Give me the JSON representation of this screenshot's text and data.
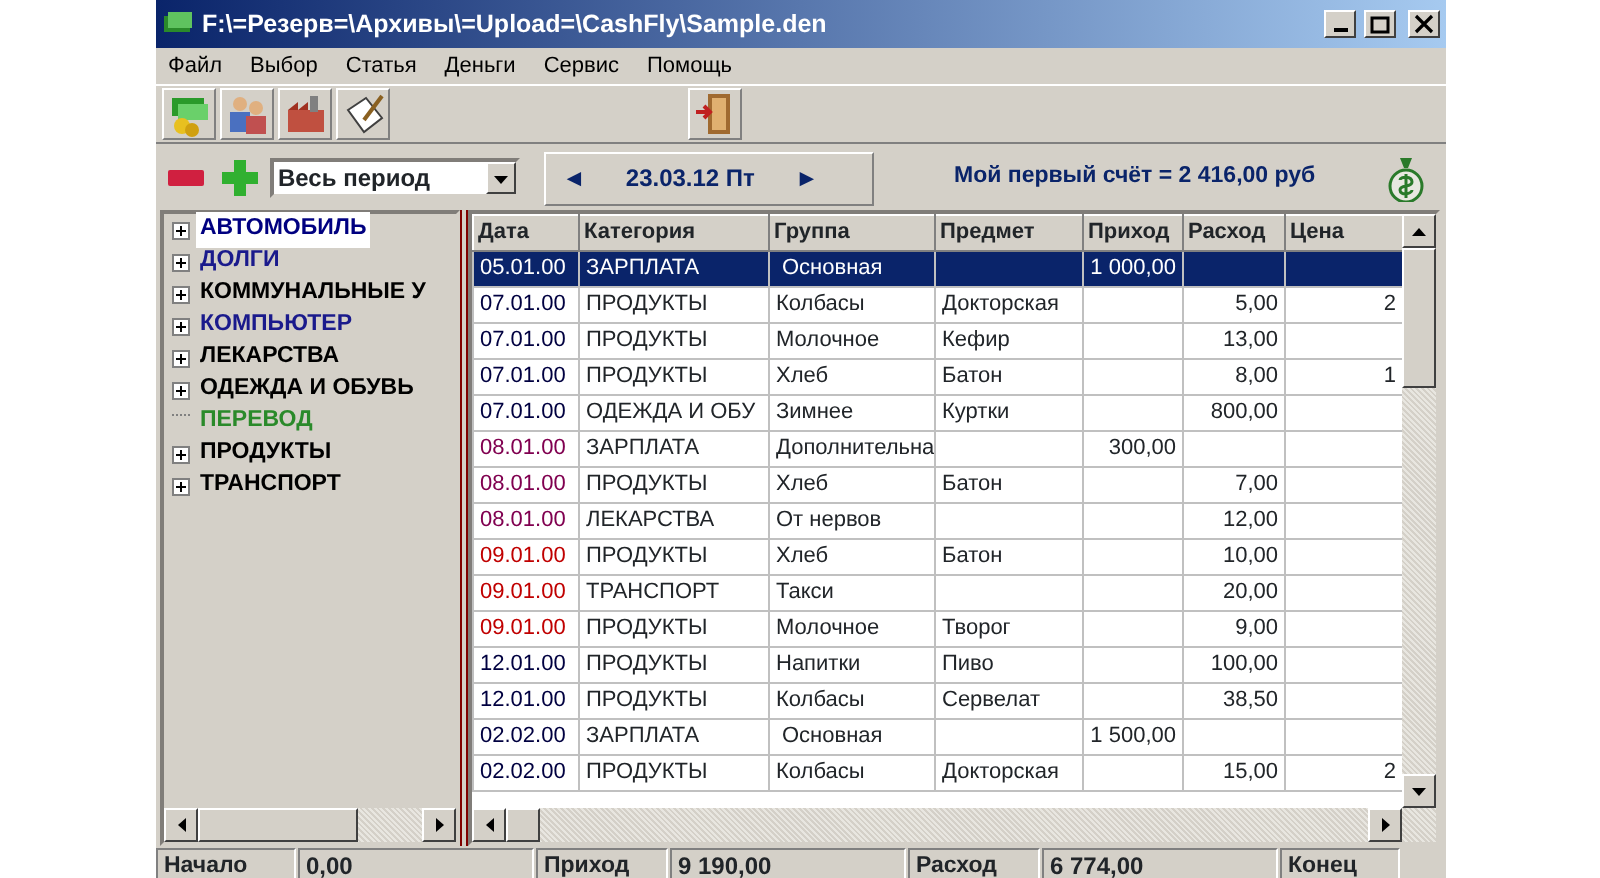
{
  "window": {
    "title": "F:\\=Резерв=\\Архивы\\=Upload=\\CashFly\\Sample.den"
  },
  "menu": [
    "Файл",
    "Выбор",
    "Статья",
    "Деньги",
    "Сервис",
    "Помощь"
  ],
  "period": {
    "value": "Весь период"
  },
  "date_nav": {
    "prev": "◄",
    "date": "23.03.12 Пт",
    "next": "►"
  },
  "account": "Мой первый счёт = 2 416,00 руб",
  "tree": [
    {
      "label": "АВТОМОБИЛЬ",
      "color": "#000080",
      "expandable": true,
      "selected": true
    },
    {
      "label": "ДОЛГИ",
      "color": "#1a1a8c",
      "expandable": true,
      "selected": false
    },
    {
      "label": "КОММУНАЛЬНЫЕ У",
      "color": "#000000",
      "expandable": true,
      "selected": false
    },
    {
      "label": "КОМПЬЮТЕР",
      "color": "#1a1a8c",
      "expandable": true,
      "selected": false
    },
    {
      "label": "ЛЕКАРСТВА",
      "color": "#000000",
      "expandable": true,
      "selected": false
    },
    {
      "label": "ОДЕЖДА И ОБУВЬ",
      "color": "#000000",
      "expandable": true,
      "selected": false
    },
    {
      "label": "ПЕРЕВОД",
      "color": "#2a8a2a",
      "expandable": false,
      "selected": false
    },
    {
      "label": "ПРОДУКТЫ",
      "color": "#000000",
      "expandable": true,
      "selected": false
    },
    {
      "label": "ТРАНСПОРТ",
      "color": "#000000",
      "expandable": true,
      "selected": false
    }
  ],
  "table": {
    "columns": [
      "Дата",
      "Категория",
      "Группа",
      "Предмет",
      "Приход",
      "Расход",
      "Цена"
    ],
    "rows": [
      {
        "cells": [
          "05.01.00",
          "ЗАРПЛАТА",
          "Основная",
          "",
          "1 000,00",
          "",
          ""
        ],
        "selected": true
      },
      {
        "cells": [
          "07.01.00",
          "ПРОДУКТЫ",
          "Колбасы",
          "Докторская",
          "",
          "5,00",
          "2"
        ],
        "color": "#000040",
        "selected": false
      },
      {
        "cells": [
          "07.01.00",
          "ПРОДУКТЫ",
          "Молочное",
          "Кефир",
          "",
          "13,00",
          ""
        ],
        "color": "#000040",
        "selected": false
      },
      {
        "cells": [
          "07.01.00",
          "ПРОДУКТЫ",
          "Хлеб",
          "Батон",
          "",
          "8,00",
          "1"
        ],
        "color": "#000040",
        "selected": false
      },
      {
        "cells": [
          "07.01.00",
          "ОДЕЖДА И ОБУ",
          "Зимнее",
          "Куртки",
          "",
          "800,00",
          ""
        ],
        "color": "#000040",
        "selected": false
      },
      {
        "cells": [
          "08.01.00",
          "ЗАРПЛАТА",
          "Дополнительна",
          "",
          "300,00",
          "",
          ""
        ],
        "color": "#800050",
        "selected": false
      },
      {
        "cells": [
          "08.01.00",
          "ПРОДУКТЫ",
          "Хлеб",
          "Батон",
          "",
          "7,00",
          ""
        ],
        "color": "#800050",
        "selected": false
      },
      {
        "cells": [
          "08.01.00",
          "ЛЕКАРСТВА",
          "От нервов",
          "",
          "",
          "12,00",
          ""
        ],
        "color": "#800050",
        "selected": false
      },
      {
        "cells": [
          "09.01.00",
          "ПРОДУКТЫ",
          "Хлеб",
          "Батон",
          "",
          "10,00",
          ""
        ],
        "color": "#c00000",
        "selected": false
      },
      {
        "cells": [
          "09.01.00",
          "ТРАНСПОРТ",
          "Такси",
          "",
          "",
          "20,00",
          ""
        ],
        "color": "#c00000",
        "selected": false
      },
      {
        "cells": [
          "09.01.00",
          "ПРОДУКТЫ",
          "Молочное",
          "Творог",
          "",
          "9,00",
          ""
        ],
        "color": "#c00000",
        "selected": false
      },
      {
        "cells": [
          "12.01.00",
          "ПРОДУКТЫ",
          "Напитки",
          "Пиво",
          "",
          "100,00",
          ""
        ],
        "color": "#000040",
        "selected": false
      },
      {
        "cells": [
          "12.01.00",
          "ПРОДУКТЫ",
          "Колбасы",
          "Сервелат",
          "",
          "38,50",
          ""
        ],
        "color": "#000040",
        "selected": false
      },
      {
        "cells": [
          "02.02.00",
          "ЗАРПЛАТА",
          "Основная",
          "",
          "1 500,00",
          "",
          ""
        ],
        "color": "#000040",
        "selected": false
      },
      {
        "cells": [
          "02.02.00",
          "ПРОДУКТЫ",
          "Колбасы",
          "Докторская",
          "",
          "15,00",
          "2"
        ],
        "color": "#000040",
        "selected": false
      }
    ]
  },
  "status_bar": [
    {
      "kind": "label",
      "text": "Начало"
    },
    {
      "kind": "value",
      "text": "0,00"
    },
    {
      "kind": "label",
      "text": "Приход"
    },
    {
      "kind": "value",
      "text": "9 190,00"
    },
    {
      "kind": "label",
      "text": "Расход"
    },
    {
      "kind": "value",
      "text": "6 774,00"
    },
    {
      "kind": "label",
      "text": "Конец"
    }
  ]
}
